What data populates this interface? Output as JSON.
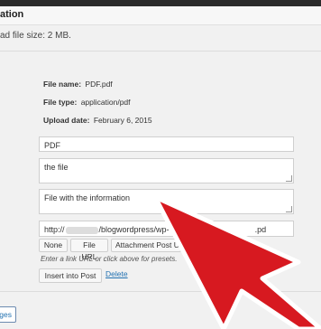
{
  "header": {
    "title": "ation"
  },
  "upload": {
    "max_size_text": "ad file size: 2 MB."
  },
  "file_info": {
    "file_name_label": "File name:",
    "file_name_value": "PDF.pdf",
    "file_type_label": "File type:",
    "file_type_value": "application/pdf",
    "upload_date_label": "Upload date:",
    "upload_date_value": "February 6, 2015"
  },
  "form": {
    "title_value": "PDF",
    "caption_value": "the file",
    "description_value": "File with the information",
    "url_prefix": "http://",
    "url_middle": "/blogwordpress/wp-",
    "url_suffix": ".pd",
    "buttons": {
      "none": "None",
      "file_url": "File URL",
      "attachment_post": "Attachment Post U"
    },
    "hint": "Enter a link URL or click above for presets.",
    "insert_button": "Insert into Post",
    "delete_link": "Delete"
  },
  "bottom": {
    "button_label": "ges"
  },
  "colors": {
    "accent_link": "#2271b1",
    "arrow_red": "#d71920",
    "arrow_outline": "#ffffff"
  }
}
